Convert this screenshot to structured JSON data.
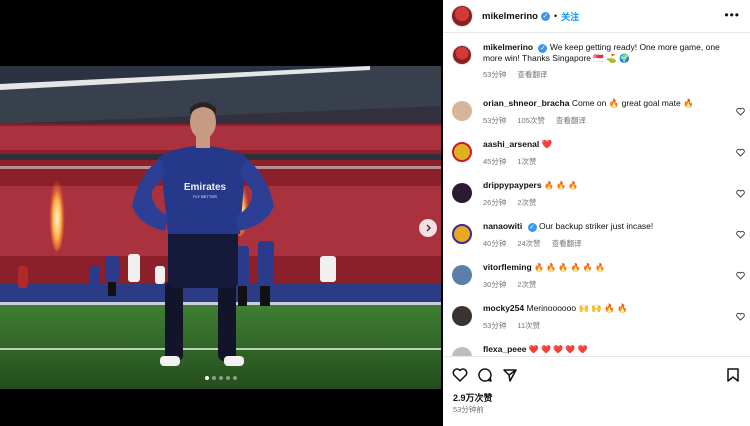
{
  "header": {
    "username": "mikelmerino",
    "separator": "•",
    "follow_label": "关注",
    "more_label": "•••"
  },
  "caption": {
    "username": "mikelmerino",
    "text": "We keep getting ready! One more game, one more win! Thanks Singapore 🇸🇬 ⛳ 🌍",
    "time": "53分钟",
    "translate": "查看翻译"
  },
  "comments": [
    {
      "username": "orian_shneor_bracha",
      "text": "Come on 🔥 great goal mate 🔥",
      "time": "53分钟",
      "likes": "105次赞",
      "translate": "查看翻译"
    },
    {
      "username": "aashi_arsenal",
      "text": "❤️",
      "time": "45分钟",
      "likes": "1次赞"
    },
    {
      "username": "drippypaypers",
      "text": "🔥 🔥 🔥",
      "time": "26分钟",
      "likes": "2次赞"
    },
    {
      "username": "nanaowiti",
      "text": "Our backup striker just incase!",
      "time": "40分钟",
      "likes": "24次赞",
      "translate": "查看翻译",
      "verified": true
    },
    {
      "username": "vitorfleming",
      "text": "🔥 🔥 🔥 🔥 🔥 🔥",
      "time": "30分钟",
      "likes": "2次赞"
    },
    {
      "username": "mocky254",
      "text": "Merinoooooo 🙌 🙌 🔥 🔥",
      "time": "53分钟",
      "likes": "11次赞"
    },
    {
      "username": "flexa_peee",
      "text": "❤️ ❤️ ❤️ ❤️ ❤️"
    }
  ],
  "footer": {
    "likes": "2.9万次赞",
    "time": "53分钟前"
  },
  "media": {
    "shirt_text": "Emirates",
    "shirt_subtext": "FLY BETTER"
  },
  "colors": {
    "accent_blue": "#0095f6",
    "verified": "#3897f0",
    "muted": "#737373"
  },
  "icons": [
    "heart-icon",
    "comment-icon",
    "share-icon",
    "bookmark-icon",
    "more-options-icon",
    "verified-icon",
    "chevron-right-icon"
  ]
}
